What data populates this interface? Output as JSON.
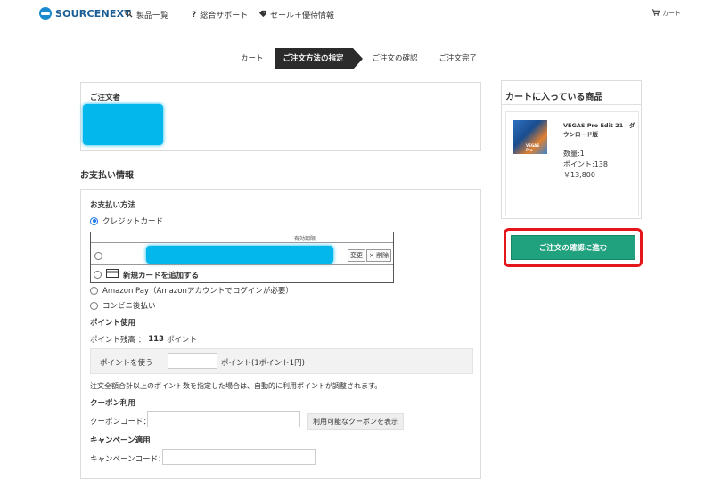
{
  "header": {
    "logo_text": "SOURCENEXT",
    "nav": [
      {
        "icon": "search-icon",
        "label": "製品一覧"
      },
      {
        "icon": "question-icon",
        "label": "総合サポート"
      },
      {
        "icon": "tag-icon",
        "label": "セール＋優待情報"
      }
    ],
    "cart_label": "カート"
  },
  "steps": [
    "カート",
    "ご注文方法の指定",
    "ご注文の確認",
    "ご注文完了"
  ],
  "orderer": {
    "heading": "ご注文者"
  },
  "payment": {
    "section_title": "お支払い情報",
    "method_heading": "お支払い方法",
    "credit_card": "クレジットカード",
    "card_table_header": "有効期限",
    "change_label": "変更",
    "delete_label": "× 削除",
    "add_card": "新規カードを追加する",
    "amazon_pay": "Amazon Pay（Amazonアカウントでログインが必要）",
    "konbini": "コンビニ後払い"
  },
  "points": {
    "heading": "ポイント使用",
    "balance_label": "ポイント残高 ：",
    "balance_value": "113",
    "balance_unit": "ポイント",
    "use_label": "ポイントを使う",
    "use_value": "",
    "rate_label": "ポイント(1ポイント1円)",
    "note": "注文全額合計以上のポイント数を指定した場合は、自動的に利用ポイントが調整されます。"
  },
  "coupon": {
    "heading": "クーポン利用",
    "code_label": "クーポンコード：",
    "code_value": "",
    "show_button": "利用可能なクーポンを表示"
  },
  "campaign": {
    "heading": "キャンペーン適用",
    "code_label": "キャンペーンコード：",
    "code_value": ""
  },
  "cart": {
    "heading": "カートに入っている商品",
    "product_name": "VEGAS Pro Edit 21　ダウンロード版",
    "quantity": "数量:1",
    "points": "ポイント:138",
    "price": "￥13,800",
    "image_text": "VEGAS Pro"
  },
  "confirm_button": "ご注文の確認に進む",
  "colors": {
    "accent_green": "#21a27e",
    "highlight_red": "#e4151b",
    "redaction_blue": "#03b6ec"
  }
}
